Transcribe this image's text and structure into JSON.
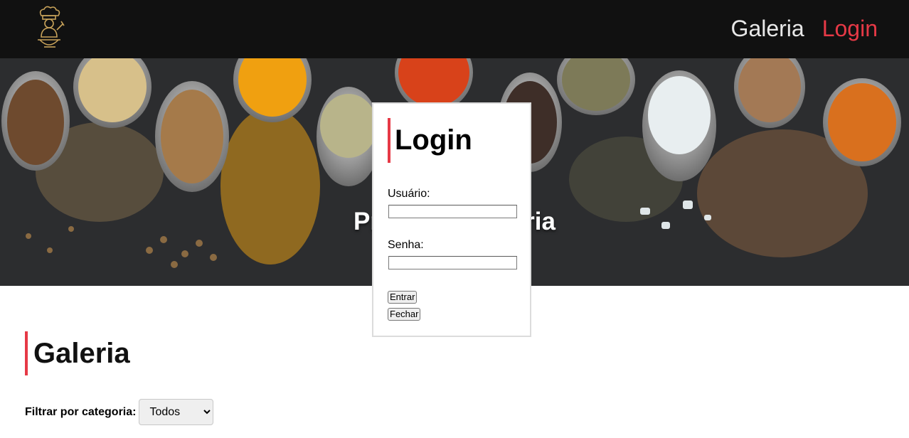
{
  "header": {
    "logo_icon": "chef-logo-icon",
    "nav": {
      "galeria_label": "Galeria",
      "login_label": "Login"
    },
    "accent_color": "#e63946"
  },
  "hero": {
    "title": "Pr                     ria"
  },
  "gallery": {
    "title": "Galeria",
    "filter_label": "Filtrar por categoria:",
    "filter_value": "Todos"
  },
  "login_modal": {
    "title": "Login",
    "username_label": "Usuário:",
    "username_value": "",
    "password_label": "Senha:",
    "password_value": "",
    "submit_label": "Entrar",
    "close_label": "Fechar"
  }
}
